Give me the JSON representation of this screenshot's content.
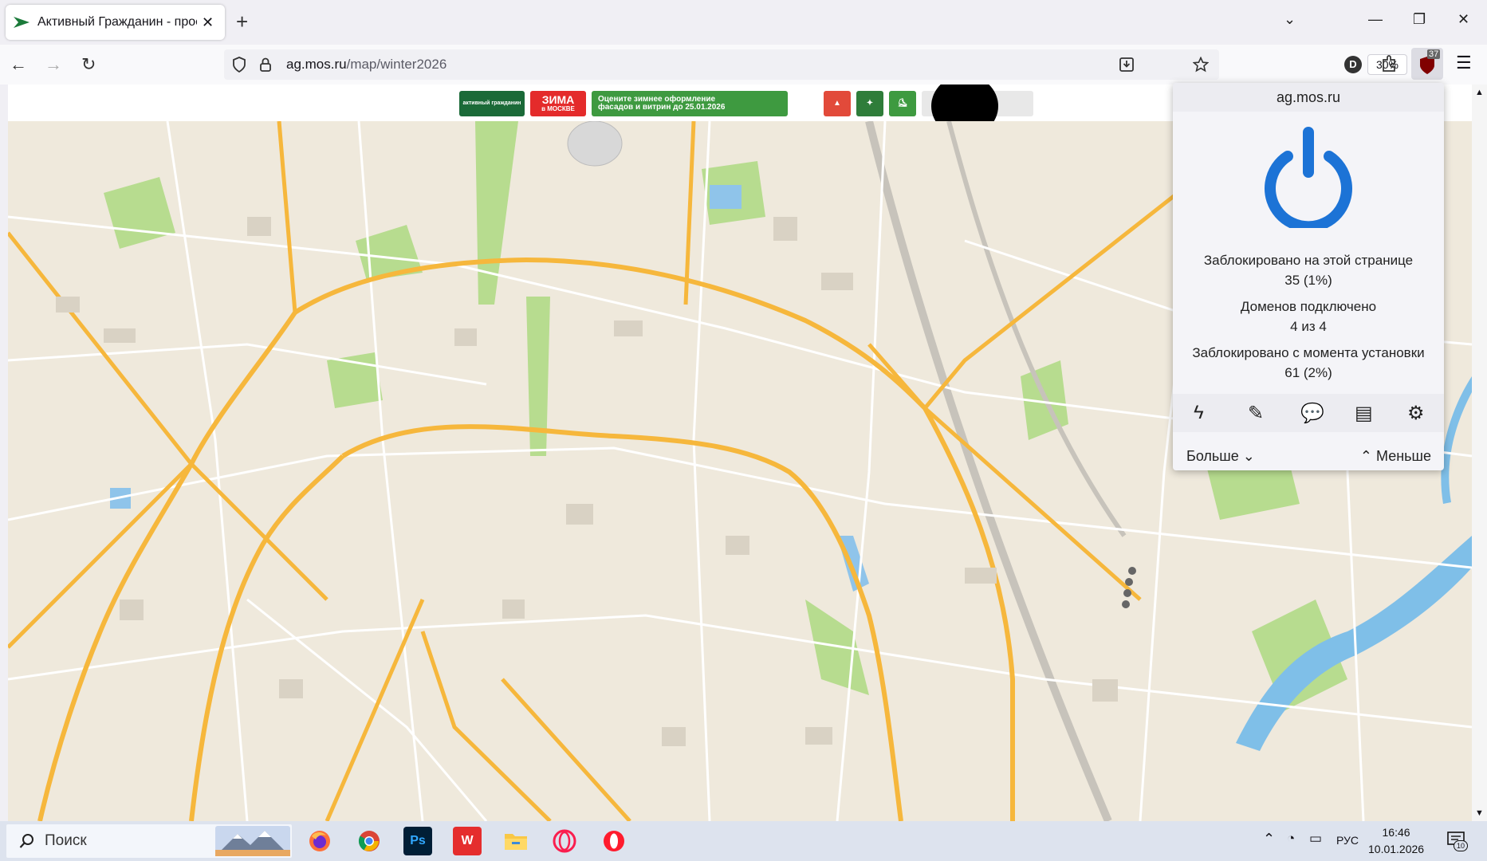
{
  "browser": {
    "tab_title": "Активный Гражданин - проект",
    "tab_close": "✕",
    "new_tab": "+",
    "url_domain": "ag.mos.ru",
    "url_path": "/map/winter2026",
    "zoom": "30%",
    "window_controls": {
      "minimize": "—",
      "restore": "❐",
      "close": "✕",
      "tab_list": "⌄"
    },
    "nav": {
      "back": "←",
      "forward": "→",
      "reload": "↻"
    },
    "ublock_badge": "37",
    "profile_letter": "D"
  },
  "banners": {
    "ag_label": "активный гражданин",
    "zima_line1": "ЗИМА",
    "zima_line2": "в МОСКВЕ",
    "promo_line1": "Оцените зимнее оформление",
    "promo_line2": "фасадов и витрин до 25.01.2026"
  },
  "popup": {
    "domain": "ag.mos.ru",
    "blocked_page_label": "Заблокировано на этой странице",
    "blocked_page_value": "35 (1%)",
    "domains_label": "Доменов подключено",
    "domains_value": "4 из 4",
    "blocked_total_label": "Заблокировано с момента установки",
    "blocked_total_value": "61 (2%)",
    "more_label": "Больше",
    "less_label": "Меньше",
    "accent": "#1c73d6"
  },
  "taskbar": {
    "search_placeholder": "Поиск",
    "lang": "РУС",
    "time": "16:46",
    "date": "10.01.2026",
    "notif_count": "10",
    "apps": [
      "firefox",
      "chrome",
      "photoshop",
      "wps-office",
      "file-explorer",
      "opera-gx",
      "opera"
    ],
    "ps_label": "Ps",
    "wps_label": "W"
  }
}
